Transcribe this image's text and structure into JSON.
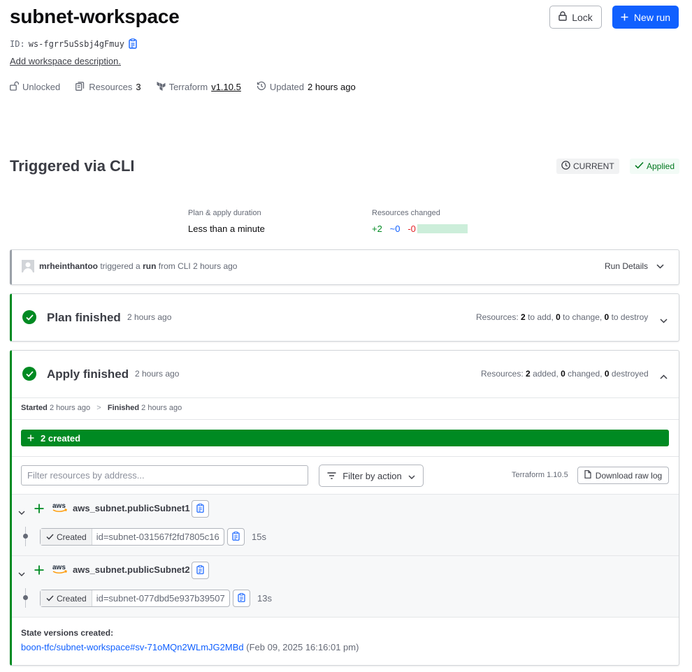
{
  "workspace": {
    "title": "subnet-workspace",
    "id_label": "ID:",
    "id_value": "ws-fgrr5uSsbj4gFmuy",
    "description_link": "Add workspace description."
  },
  "header_actions": {
    "lock_label": "Lock",
    "new_run_label": "New run"
  },
  "meta": {
    "lock_status": "Unlocked",
    "resources_label": "Resources",
    "resources_count": "3",
    "terraform_label": "Terraform",
    "terraform_version": "v1.10.5",
    "updated_label": "Updated",
    "updated_value": "2 hours ago"
  },
  "run": {
    "title": "Triggered via CLI",
    "badge_current": "CURRENT",
    "badge_applied": "Applied",
    "duration_label": "Plan & apply duration",
    "duration_value": "Less than a minute",
    "resources_changed_label": "Resources changed",
    "changed_add": "+2",
    "changed_change": "~0",
    "changed_destroy": "-0"
  },
  "trigger": {
    "user": "mrheinthantoo",
    "text1": "triggered a",
    "run_word": "run",
    "text2": "from CLI 2 hours ago",
    "details_label": "Run Details"
  },
  "plan": {
    "title": "Plan finished",
    "time": "2 hours ago",
    "resources_label": "Resources:",
    "add_count": "2",
    "add_text": "to add,",
    "change_count": "0",
    "change_text": "to change,",
    "destroy_count": "0",
    "destroy_text": "to destroy"
  },
  "apply": {
    "title": "Apply finished",
    "time": "2 hours ago",
    "resources_label": "Resources:",
    "added_count": "2",
    "added_text": "added,",
    "changed_count": "0",
    "changed_text": "changed,",
    "destroyed_count": "0",
    "destroyed_text": "destroyed",
    "started_label": "Started",
    "started_time": "2 hours ago",
    "separator": ">",
    "finished_label": "Finished",
    "finished_time": "2 hours ago",
    "created_bar": "2 created",
    "filter_placeholder": "Filter resources by address...",
    "filter_action_label": "Filter by action",
    "terraform_version": "Terraform 1.10.5",
    "download_label": "Download raw log",
    "resources": [
      {
        "provider": "aws",
        "address": "aws_subnet.publicSubnet1",
        "status": "Created",
        "resource_id": "id=subnet-031567f2fd7805c16",
        "duration": "15s"
      },
      {
        "provider": "aws",
        "address": "aws_subnet.publicSubnet2",
        "status": "Created",
        "resource_id": "id=subnet-077dbd5e937b39507",
        "duration": "13s"
      }
    ],
    "state_label": "State versions created:",
    "state_link": "boon-tfc/subnet-workspace#sv-71oMQn2WLmJG2MBd",
    "state_date": "(Feb 09, 2025 16:16:01 pm)"
  },
  "colors": {
    "primary": "#1060ff",
    "success": "#008a22",
    "danger": "#e52228",
    "text": "#3b3d45"
  }
}
